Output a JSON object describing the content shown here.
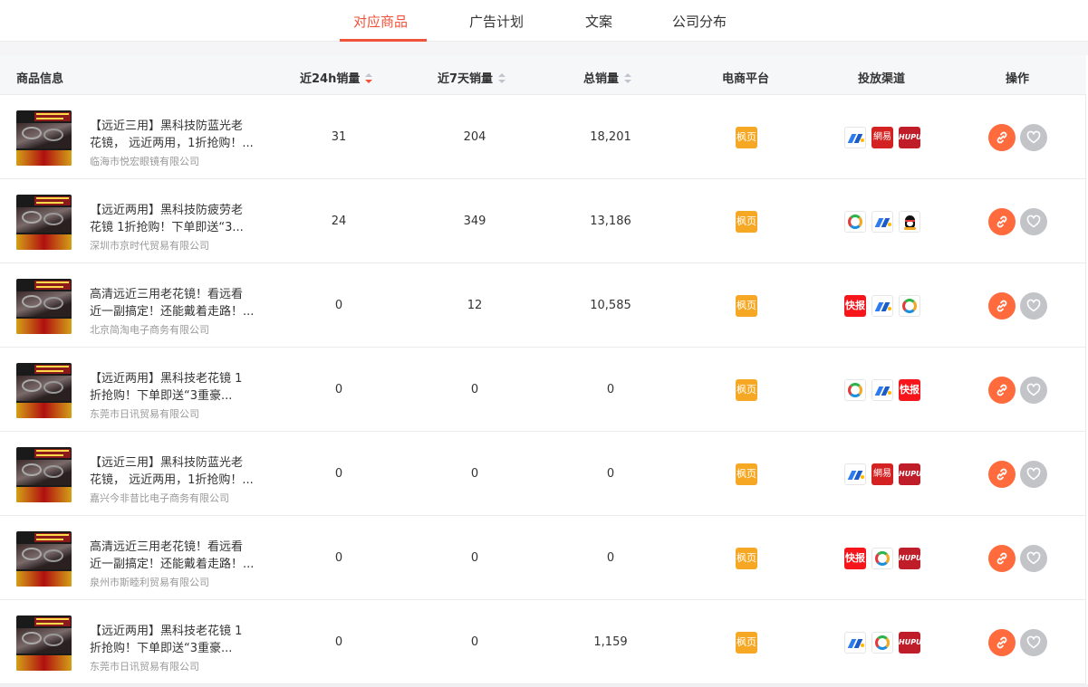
{
  "tabs": [
    {
      "label": "对应商品",
      "active": true
    },
    {
      "label": "广告计划",
      "active": false
    },
    {
      "label": "文案",
      "active": false
    },
    {
      "label": "公司分布",
      "active": false
    }
  ],
  "headers": {
    "product": "商品信息",
    "sales24h": "近24h销量",
    "sales7d": "近7天销量",
    "total": "总销量",
    "platform": "电商平台",
    "channel": "投放渠道",
    "action": "操作"
  },
  "sort": {
    "active_column": "sales24h",
    "direction": "desc"
  },
  "colors": {
    "accent": "#f0523a",
    "platform": "#f6a723",
    "link_button": "#ff6b3d",
    "fav_button": "#c2c4c8"
  },
  "rows": [
    {
      "name1": "【远近三用】黑科技防蓝光老",
      "name2": "花镜， 远近两用，1折抢购！...",
      "company": "临海市悦宏眼镜有限公司",
      "sales24h": "31",
      "sales7d": "204",
      "total": "18,201",
      "platform": "枫页",
      "channels": [
        "zhihu",
        "163",
        "hupu"
      ],
      "channel_labels": [
        "",
        "網易",
        "HUPU"
      ]
    },
    {
      "name1": "【远近两用】黑科技防疲劳老",
      "name2": "花镜 1折抢购！下单即送“3...",
      "company": "深圳市京时代贸易有限公司",
      "sales24h": "24",
      "sales7d": "349",
      "total": "13,186",
      "platform": "枫页",
      "channels": [
        "tencent",
        "zhihu",
        "qq"
      ],
      "channel_labels": [
        "",
        "",
        ""
      ]
    },
    {
      "name1": "高清远近三用老花镜！看远看",
      "name2": "近一副搞定！还能戴着走路！...",
      "company": "北京简淘电子商务有限公司",
      "sales24h": "0",
      "sales7d": "12",
      "total": "10,585",
      "platform": "枫页",
      "channels": [
        "kuaishou",
        "zhihu",
        "tencent"
      ],
      "channel_labels": [
        "快报",
        "",
        ""
      ]
    },
    {
      "name1": "【远近两用】黑科技老花镜 1",
      "name2": "折抢购！下单即送“3重豪...",
      "company": "东莞市日讯贸易有限公司",
      "sales24h": "0",
      "sales7d": "0",
      "total": "0",
      "platform": "枫页",
      "channels": [
        "tencent",
        "zhihu",
        "kuaishou"
      ],
      "channel_labels": [
        "",
        "",
        "快报"
      ]
    },
    {
      "name1": "【远近三用】黑科技防蓝光老",
      "name2": "花镜， 远近两用，1折抢购！...",
      "company": "嘉兴今非昔比电子商务有限公司",
      "sales24h": "0",
      "sales7d": "0",
      "total": "0",
      "platform": "枫页",
      "channels": [
        "zhihu",
        "163",
        "hupu"
      ],
      "channel_labels": [
        "",
        "網易",
        "HUPU"
      ]
    },
    {
      "name1": "高清远近三用老花镜！看远看",
      "name2": "近一副搞定！还能戴着走路！...",
      "company": "泉州市斯睦利贸易有限公司",
      "sales24h": "0",
      "sales7d": "0",
      "total": "0",
      "platform": "枫页",
      "channels": [
        "kuaishou",
        "tencent",
        "hupu"
      ],
      "channel_labels": [
        "快报",
        "",
        "HUPU"
      ]
    },
    {
      "name1": "【远近两用】黑科技老花镜 1",
      "name2": "折抢购！下单即送“3重豪...",
      "company": "东莞市日讯贸易有限公司",
      "sales24h": "0",
      "sales7d": "0",
      "total": "1,159",
      "platform": "枫页",
      "channels": [
        "zhihu",
        "tencent",
        "hupu"
      ],
      "channel_labels": [
        "",
        "",
        "HUPU"
      ]
    }
  ]
}
